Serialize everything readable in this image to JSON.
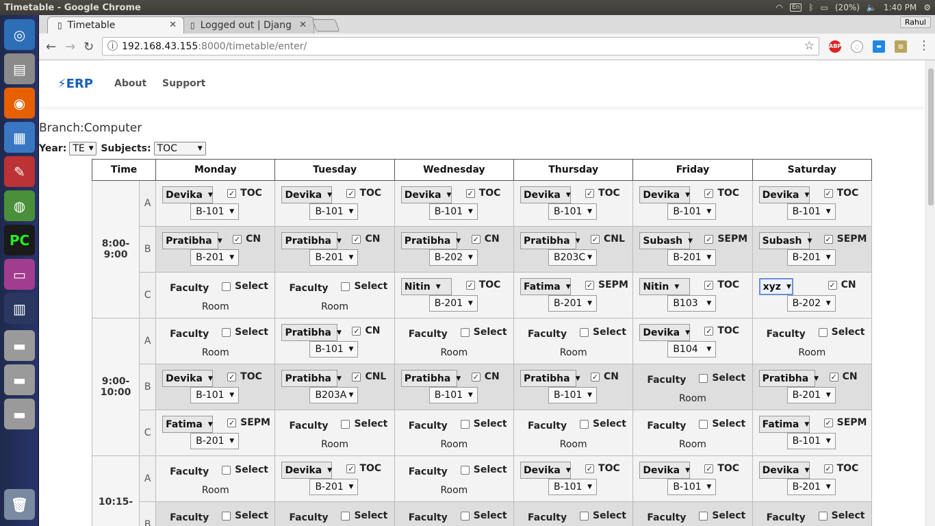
{
  "window_title": "Timetable - Google Chrome",
  "system": {
    "keyboard": "En",
    "battery": "(20%)",
    "clock": "1:40 PM"
  },
  "tabs": [
    {
      "label": "Timetable",
      "active": true
    },
    {
      "label": "Logged out | Djang",
      "active": false
    }
  ],
  "profile": "Rahul",
  "url": {
    "host": "192.168.43.155",
    "path": ":8000/timetable/enter/"
  },
  "nav": {
    "brand": "ERP",
    "links": [
      "About",
      "Support"
    ]
  },
  "branch": "Branch:Computer",
  "filters": {
    "year_label": "Year:",
    "year_value": "TE",
    "subjects_label": "Subjects:",
    "subjects_value": "TOC"
  },
  "headers": [
    "Time",
    "Monday",
    "Tuesday",
    "Wednesday",
    "Thursday",
    "Friday",
    "Saturday"
  ],
  "labels": {
    "faculty": "Faculty",
    "select": "Select",
    "room": "Room"
  },
  "slots": [
    {
      "time": "8:00-\n9:00",
      "rows": [
        {
          "batch": "A",
          "cells": [
            {
              "faculty": "Devika",
              "subject": "TOC",
              "room": "B-101"
            },
            {
              "faculty": "Devika",
              "subject": "TOC",
              "room": "B-101"
            },
            {
              "faculty": "Devika",
              "subject": "TOC",
              "room": "B-101"
            },
            {
              "faculty": "Devika",
              "subject": "TOC",
              "room": "B-101"
            },
            {
              "faculty": "Devika",
              "subject": "TOC",
              "room": "B-101"
            },
            {
              "faculty": "Devika",
              "subject": "TOC",
              "room": "B-101"
            }
          ]
        },
        {
          "batch": "B",
          "cells": [
            {
              "faculty": "Pratibha",
              "subject": "CN",
              "room": "B-201"
            },
            {
              "faculty": "Pratibha",
              "subject": "CN",
              "room": "B-201"
            },
            {
              "faculty": "Pratibha",
              "subject": "CN",
              "room": "B-202"
            },
            {
              "faculty": "Pratibha",
              "subject": "CNL",
              "room": "B203C"
            },
            {
              "faculty": "Subash",
              "subject": "SEPM",
              "room": "B-201"
            },
            {
              "faculty": "Subash",
              "subject": "SEPM",
              "room": "B-201"
            }
          ]
        },
        {
          "batch": "C",
          "cells": [
            null,
            null,
            {
              "faculty": "Nitin",
              "subject": "TOC",
              "room": "B-201"
            },
            {
              "faculty": "Fatima",
              "subject": "SEPM",
              "room": "B-201"
            },
            {
              "faculty": "Nitin",
              "subject": "TOC",
              "room": "B103"
            },
            {
              "faculty": "xyz",
              "subject": "CN",
              "room": "B-202",
              "focus": true
            }
          ]
        }
      ]
    },
    {
      "time": "9:00-\n10:00",
      "rows": [
        {
          "batch": "A",
          "cells": [
            null,
            {
              "faculty": "Pratibha",
              "subject": "CN",
              "room": "B-101"
            },
            null,
            null,
            {
              "faculty": "Devika",
              "subject": "TOC",
              "room": "B104"
            },
            null
          ]
        },
        {
          "batch": "B",
          "cells": [
            {
              "faculty": "Devika",
              "subject": "TOC",
              "room": "B-101"
            },
            {
              "faculty": "Pratibha",
              "subject": "CNL",
              "room": "B203A"
            },
            {
              "faculty": "Pratibha",
              "subject": "CN",
              "room": "B-101"
            },
            {
              "faculty": "Pratibha",
              "subject": "CN",
              "room": "B-101"
            },
            null,
            {
              "faculty": "Pratibha",
              "subject": "CN",
              "room": "B-201"
            }
          ]
        },
        {
          "batch": "C",
          "cells": [
            {
              "faculty": "Fatima",
              "subject": "SEPM",
              "room": "B-201"
            },
            null,
            null,
            null,
            null,
            {
              "faculty": "Fatima",
              "subject": "SEPM",
              "room": "B-101"
            }
          ]
        }
      ]
    },
    {
      "time": "10:15-",
      "rows": [
        {
          "batch": "A",
          "cells": [
            null,
            {
              "faculty": "Devika",
              "subject": "TOC",
              "room": "B-201"
            },
            null,
            {
              "faculty": "Devika",
              "subject": "TOC",
              "room": "B-101"
            },
            {
              "faculty": "Devika",
              "subject": "TOC",
              "room": "B-101"
            },
            {
              "faculty": "Devika",
              "subject": "TOC",
              "room": "B-201"
            }
          ]
        },
        {
          "batch": "B",
          "cells": [
            null,
            null,
            null,
            null,
            null,
            null
          ]
        }
      ]
    }
  ],
  "colors": {
    "brand": "#1a5fb4",
    "launcher": "#28346a"
  }
}
